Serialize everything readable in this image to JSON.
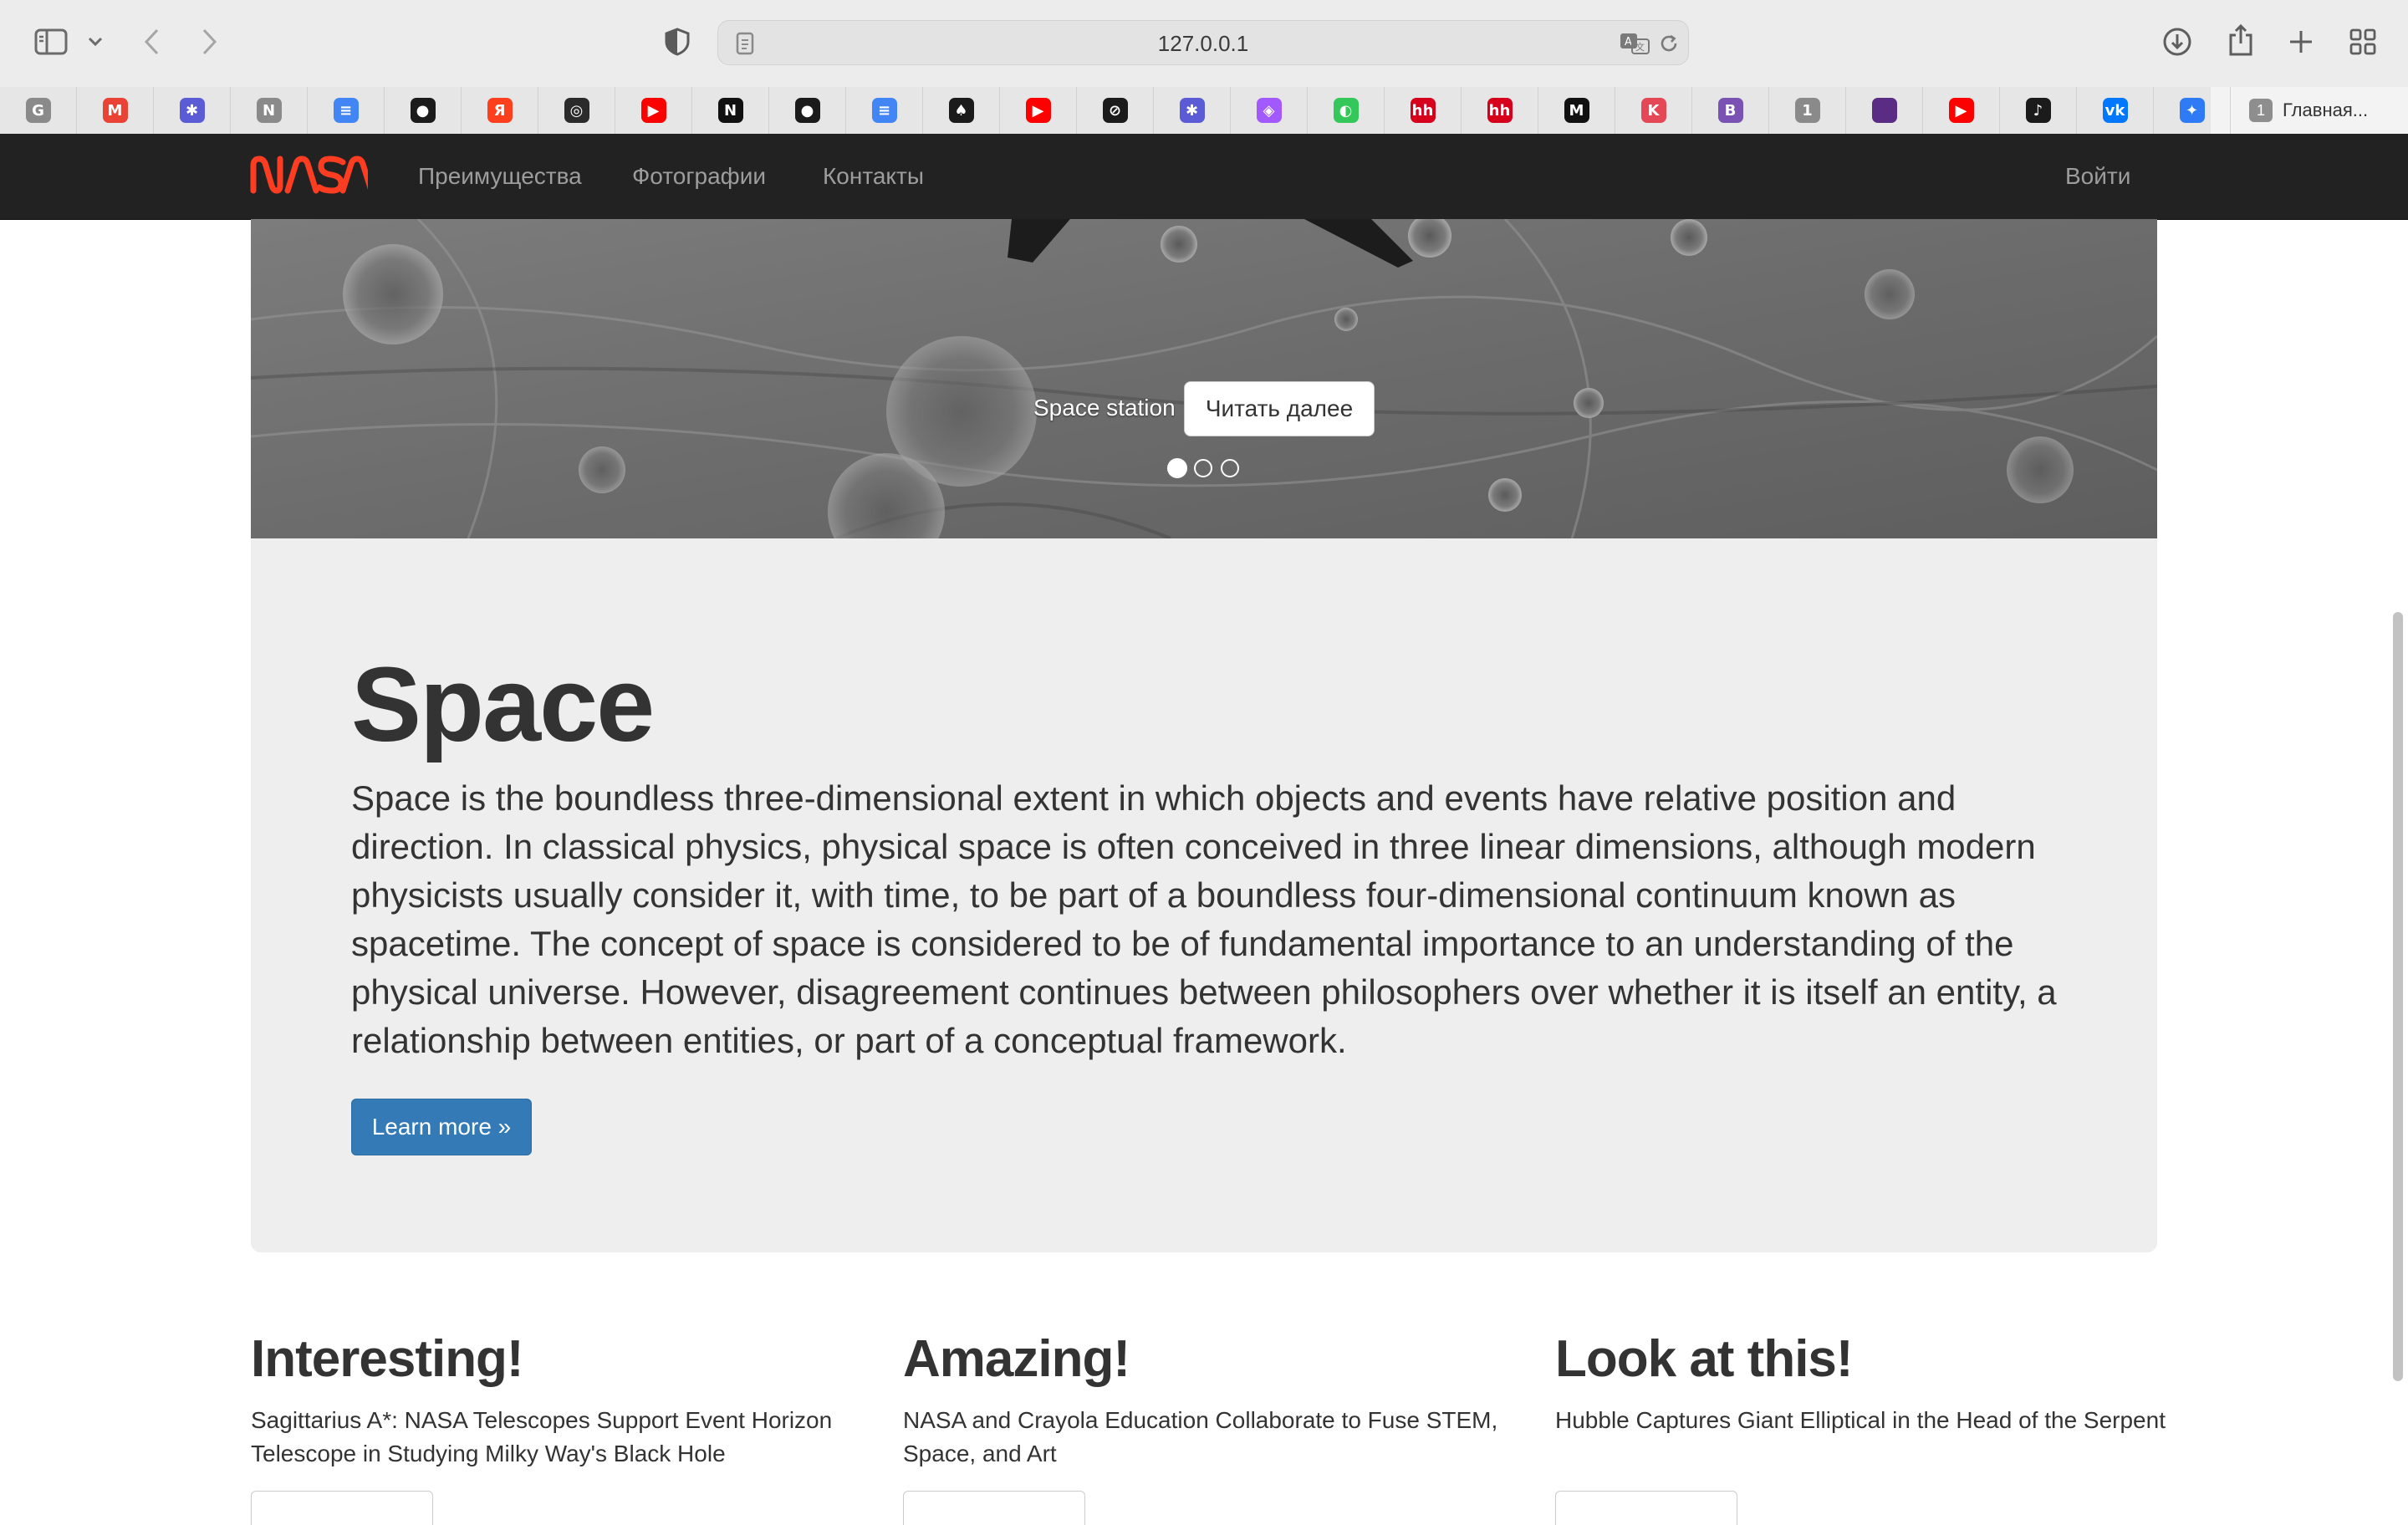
{
  "browser": {
    "url": "127.0.0.1",
    "last_tab": {
      "badge": "1",
      "label": "Главная..."
    },
    "bookmarks": [
      {
        "icon": "g-square-icon",
        "glyph": "G",
        "color": "#8a8a8a"
      },
      {
        "icon": "gmail-icon",
        "glyph": "M",
        "color": "#ea4335"
      },
      {
        "icon": "puzzle-app-icon",
        "glyph": "✱",
        "color": "#5b5bd6"
      },
      {
        "icon": "n-square-icon",
        "glyph": "N",
        "color": "#8a8a8a"
      },
      {
        "icon": "google-docs-icon",
        "glyph": "≡",
        "color": "#4285f4"
      },
      {
        "icon": "github-icon",
        "glyph": "●",
        "color": "#1b1b1b"
      },
      {
        "icon": "yandex-icon",
        "glyph": "Я",
        "color": "#fc3f1d"
      },
      {
        "icon": "openai-icon",
        "glyph": "◎",
        "color": "#2b2b2b"
      },
      {
        "icon": "youtube-icon",
        "glyph": "▶",
        "color": "#ff0000"
      },
      {
        "icon": "notion-icon",
        "glyph": "N",
        "color": "#111111"
      },
      {
        "icon": "github-icon",
        "glyph": "●",
        "color": "#1b1b1b"
      },
      {
        "icon": "google-docs-icon",
        "glyph": "≡",
        "color": "#4285f4"
      },
      {
        "icon": "spade-icon",
        "glyph": "♠",
        "color": "#1b1b1b"
      },
      {
        "icon": "youtube-icon",
        "glyph": "▶",
        "color": "#ff0000"
      },
      {
        "icon": "linear-icon",
        "glyph": "⊘",
        "color": "#1b1b1b"
      },
      {
        "icon": "puzzle-app-icon",
        "glyph": "✱",
        "color": "#5b5bd6"
      },
      {
        "icon": "figma-icon",
        "glyph": "◈",
        "color": "#a259ff"
      },
      {
        "icon": "green-app-icon",
        "glyph": "◐",
        "color": "#34c759"
      },
      {
        "icon": "hh-icon",
        "glyph": "hh",
        "color": "#d6001c"
      },
      {
        "icon": "hh-icon",
        "glyph": "hh",
        "color": "#d6001c"
      },
      {
        "icon": "medium-icon",
        "glyph": "M",
        "color": "#111111"
      },
      {
        "icon": "kotlin-icon",
        "glyph": "K",
        "color": "#e44857"
      },
      {
        "icon": "bootstrap-icon",
        "glyph": "B",
        "color": "#7952b3"
      },
      {
        "icon": "one-square-icon",
        "glyph": "1",
        "color": "#8a8a8a"
      },
      {
        "icon": "purple-app-icon",
        "glyph": "",
        "color": "#5b2c83"
      },
      {
        "icon": "youtube-icon",
        "glyph": "▶",
        "color": "#ff0000"
      },
      {
        "icon": "skipping-icon",
        "glyph": "♪",
        "color": "#1b1b1b"
      },
      {
        "icon": "vk-icon",
        "glyph": "vk",
        "color": "#0077ff"
      },
      {
        "icon": "feather-app-icon",
        "glyph": "✦",
        "color": "#2f7bf5"
      }
    ]
  },
  "navbar": {
    "brand": "NASA",
    "brand_color": "#fc3d21",
    "links": [
      "Преимущества",
      "Фотографии",
      "Контакты"
    ],
    "login": "Войти"
  },
  "carousel": {
    "caption": "Space station",
    "button": "Читать далее",
    "slide_count": 3,
    "active_slide": 1
  },
  "jumbotron": {
    "title": "Space",
    "text": "Space is the boundless three-dimensional extent in which objects and events have relative position and direction. In classical physics, physical space is often conceived in three linear dimensions, although modern physicists usually consider it, with time, to be part of a boundless four-dimensional continuum known as spacetime. The concept of space is considered to be of fundamental importance to an understanding of the physical universe. However, disagreement continues between philosophers over whether it is itself an entity, a relationship between entities, or part of a conceptual framework.",
    "button": "Learn more »",
    "button_color": "#337ab7"
  },
  "columns": [
    {
      "heading": "Interesting!",
      "text": "Sagittarius A*: NASA Telescopes Support Event Horizon Telescope in Studying Milky Way's Black Hole"
    },
    {
      "heading": "Amazing!",
      "text": "NASA and Crayola Education Collaborate to Fuse STEM, Space, and Art"
    },
    {
      "heading": "Look at this!",
      "text": "Hubble Captures Giant Elliptical in the Head of the Serpent"
    }
  ]
}
